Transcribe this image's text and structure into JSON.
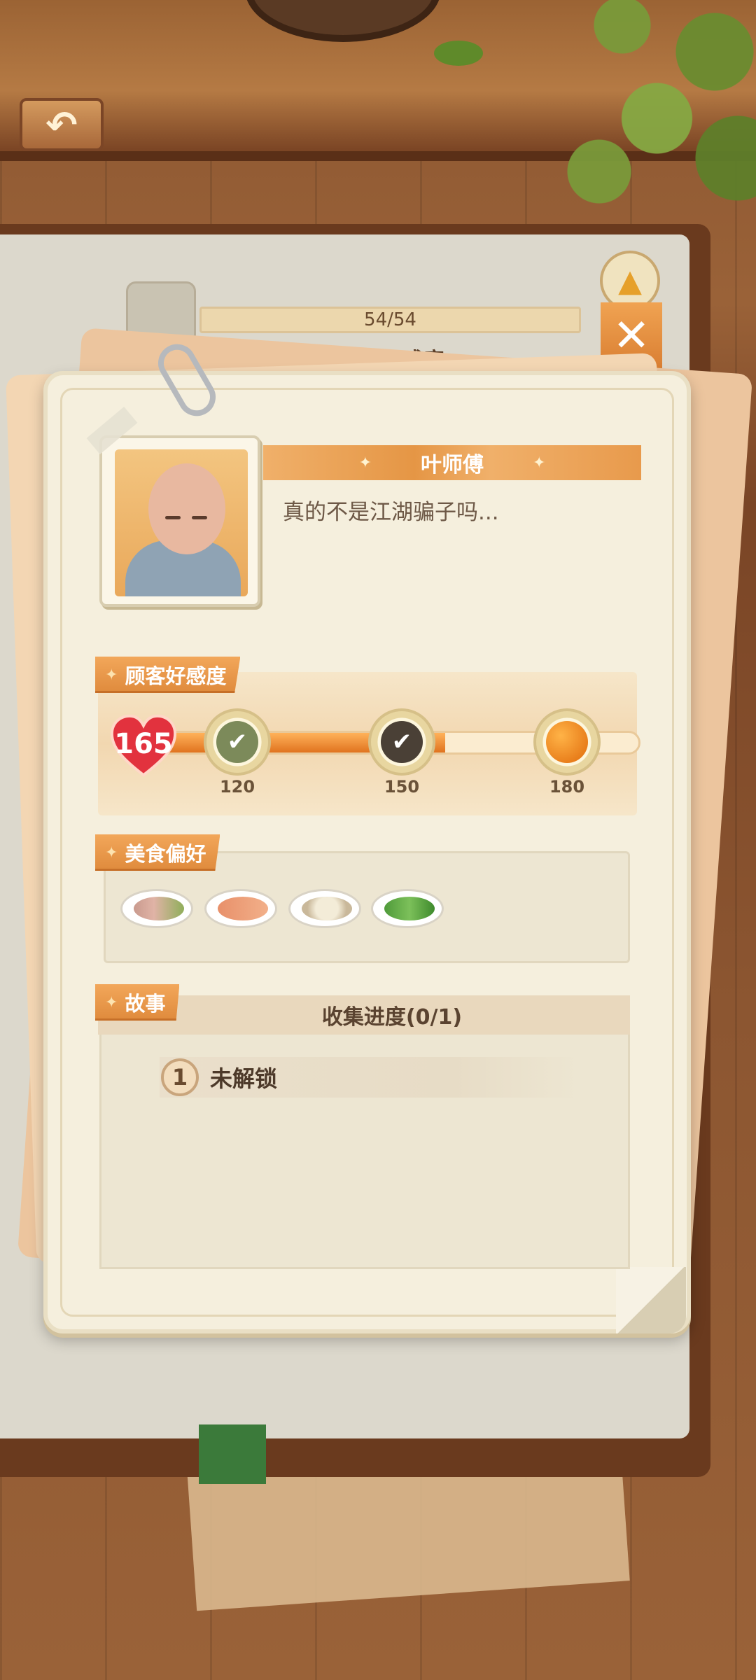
{
  "header": {
    "progress_text": "54/54",
    "subtitle": "...顾客打火锅牌加好感度"
  },
  "customer": {
    "name": "叶师傅",
    "quote": "真的不是江湖骗子吗..."
  },
  "favor": {
    "section_label": "顾客好感度",
    "current": "165",
    "progress_fraction": 0.605,
    "milestones": [
      {
        "value": "120",
        "status": "claimed",
        "icon": "check-icon"
      },
      {
        "value": "150",
        "status": "claimed",
        "icon": "check-icon"
      },
      {
        "value": "180",
        "status": "locked",
        "icon": "orange-orb-icon"
      }
    ]
  },
  "food": {
    "section_label": "美食偏好",
    "dishes": [
      {
        "name": "meat-platter-icon"
      },
      {
        "name": "shrimp-dish-icon"
      },
      {
        "name": "mushroom-dish-icon"
      },
      {
        "name": "greens-dish-icon"
      }
    ]
  },
  "story": {
    "section_label": "故事",
    "collection_progress": "收集进度(0/1)",
    "items": [
      {
        "index": "1",
        "label": "未解锁"
      }
    ]
  },
  "colors": {
    "accent_orange": "#e59645",
    "card_bg": "#f5efdd",
    "heart_red": "#e2323e"
  }
}
